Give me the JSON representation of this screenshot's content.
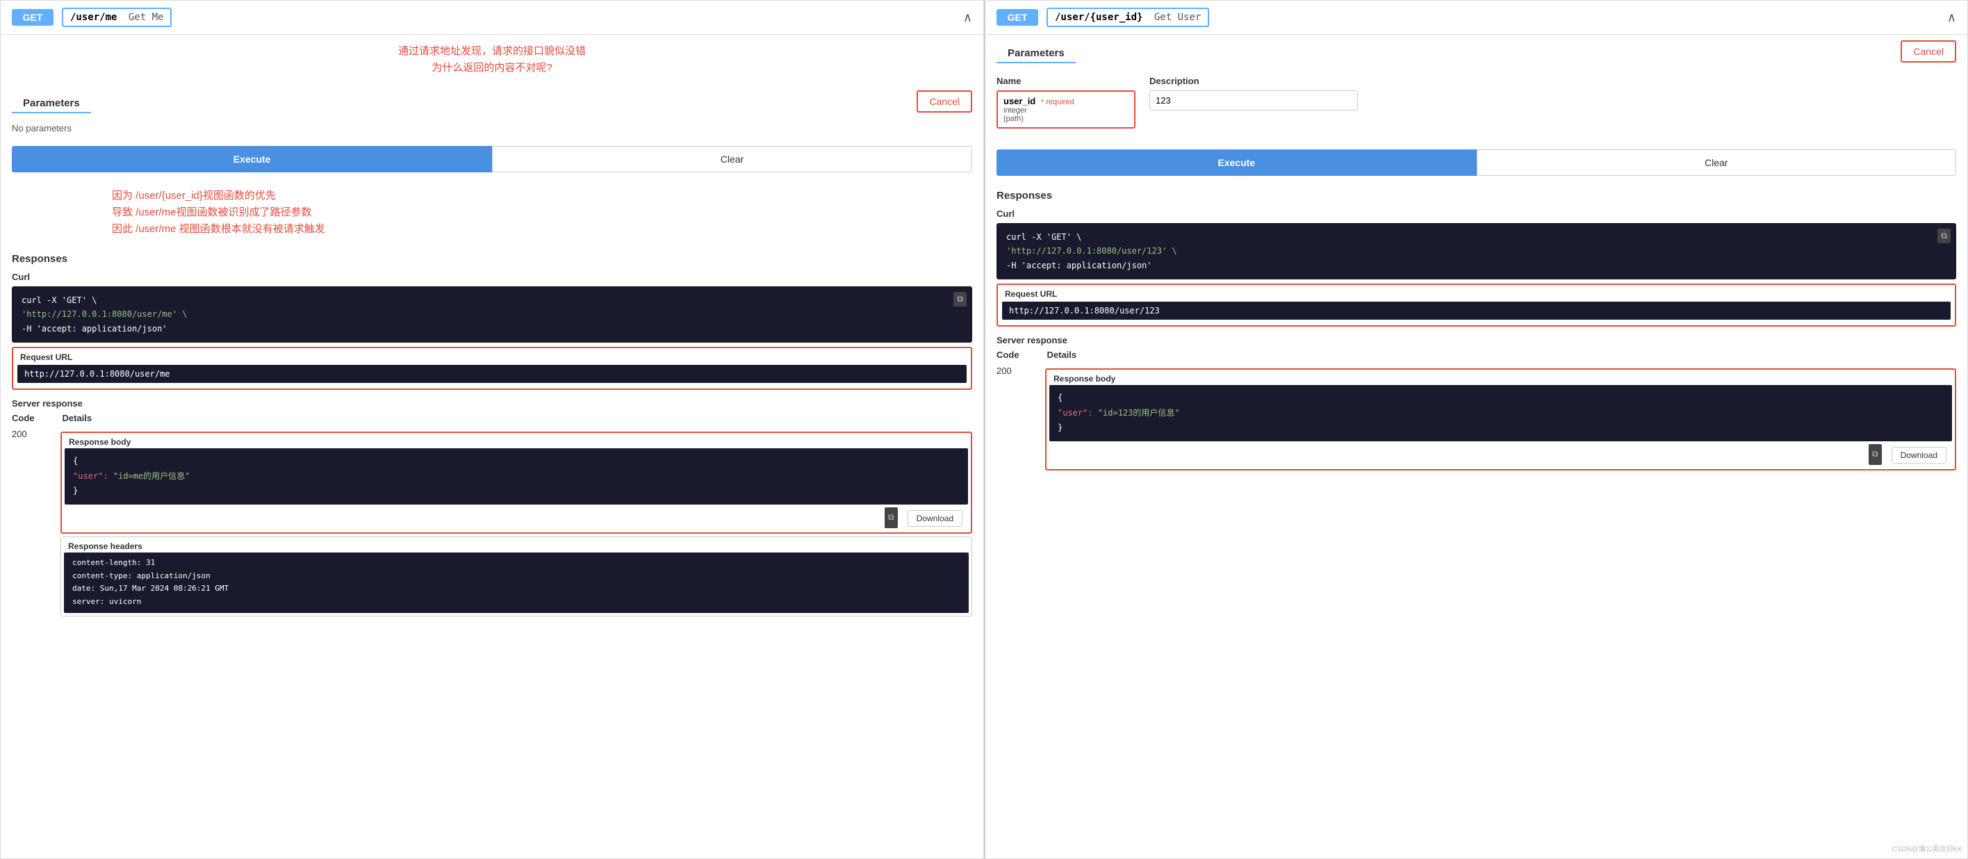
{
  "left_panel": {
    "method": "GET",
    "path_main": "/user/me",
    "path_desc": "Get Me",
    "annotation1": "通过请求地址发现，请求的接口貌似没错",
    "annotation2": "为什么返回的内容不对呢?",
    "annotation3": "因为 /user/{user_id}视图函数的优先",
    "annotation4": "导致 /user/me视图函数被识别成了路径参数",
    "annotation5": "因此 /user/me 视图函数根本就没有被请求触发",
    "params_label": "Parameters",
    "cancel_label": "Cancel",
    "no_params": "No parameters",
    "execute_label": "Execute",
    "clear_label": "Clear",
    "responses_label": "Responses",
    "curl_label": "Curl",
    "curl_line1": "curl -X 'GET' \\",
    "curl_line2": "  'http://127.0.0.1:8080/user/me' \\",
    "curl_line3": "  -H 'accept: application/json'",
    "request_url_label": "Request URL",
    "request_url_value": "http://127.0.0.1:8080/user/me",
    "server_response_label": "Server response",
    "code_label": "Code",
    "details_label": "Details",
    "response_code": "200",
    "response_body_label": "Response body",
    "response_body_line1": "{",
    "response_body_key": "  \"user\":",
    "response_body_val": "\"id=me的用户信息\"",
    "response_body_line3": "}",
    "download_label": "Download",
    "response_headers_label": "Response headers",
    "header_line1": "content-length: 31",
    "header_line2": "content-type: application/json",
    "header_line3": "date: Sun,17 Mar 2024 08:26:21 GMT",
    "header_line4": "server: uvicorn"
  },
  "right_panel": {
    "method": "GET",
    "path_main": "/user/{user_id}",
    "path_desc": "Get User",
    "params_label": "Parameters",
    "cancel_label": "Cancel",
    "name_col": "Name",
    "desc_col": "Description",
    "param_name": "user_id",
    "param_required": "* required",
    "param_type": "integer",
    "param_location": "(path)",
    "param_value": "123",
    "execute_label": "Execute",
    "clear_label": "Clear",
    "responses_label": "Responses",
    "curl_label": "Curl",
    "curl_line1": "curl -X 'GET' \\",
    "curl_line2": "  'http://127.0.0.1:8080/user/123' \\",
    "curl_line3": "  -H 'accept: application/json'",
    "request_url_label": "Request URL",
    "request_url_value": "http://127.0.0.1:8080/user/123",
    "server_response_label": "Server response",
    "code_label": "Code",
    "details_label": "Details",
    "response_code": "200",
    "response_body_label": "Response body",
    "response_body_line1": "{",
    "response_body_key": "  \"user\":",
    "response_body_val": "\"id=123的用户信息\"",
    "response_body_line3": "}",
    "download_label": "Download"
  },
  "watermark": "CSDN@蒲公英信仰KK"
}
